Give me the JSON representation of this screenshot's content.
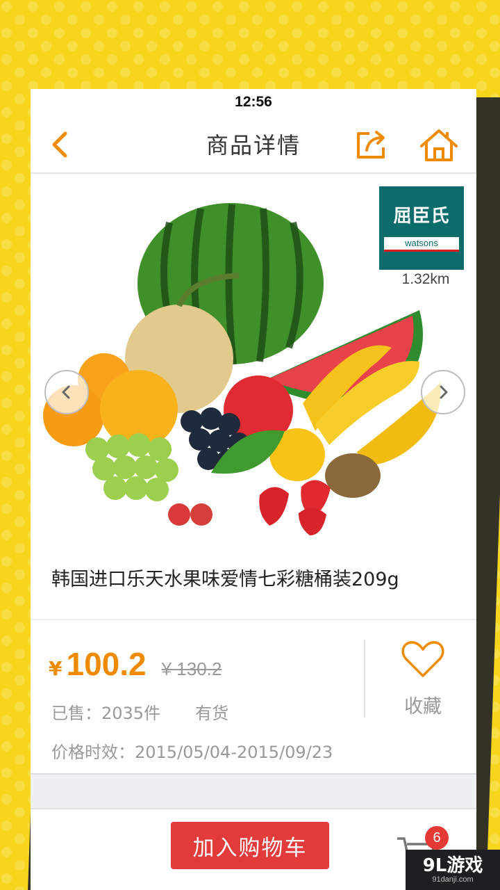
{
  "status_bar": {
    "time": "12:56"
  },
  "nav": {
    "title": "商品详情",
    "back_icon": "chevron-left-icon",
    "share_icon": "share-icon",
    "home_icon": "home-icon"
  },
  "store": {
    "name_cn": "屈臣氏",
    "name_en": "watsons",
    "distance": "1.32km"
  },
  "product": {
    "title": "韩国进口乐天水果味爱情七彩糖桶装209g",
    "currency": "¥",
    "price": "100.2",
    "original_price": "¥ 130.2",
    "sold": "已售：2035件",
    "stock": "有货",
    "validity": "价格时效：2015/05/04-2015/09/23",
    "favorite_label": "收藏"
  },
  "bottom": {
    "add_to_cart": "加入购物车",
    "cart_count": "6"
  },
  "watermark": {
    "main": "9L游戏",
    "sub": "91danji.com"
  },
  "colors": {
    "accent": "#f08a00",
    "cart_button": "#e33a3a",
    "background": "#f7d51c",
    "store_brand": "#0c6b6b"
  }
}
